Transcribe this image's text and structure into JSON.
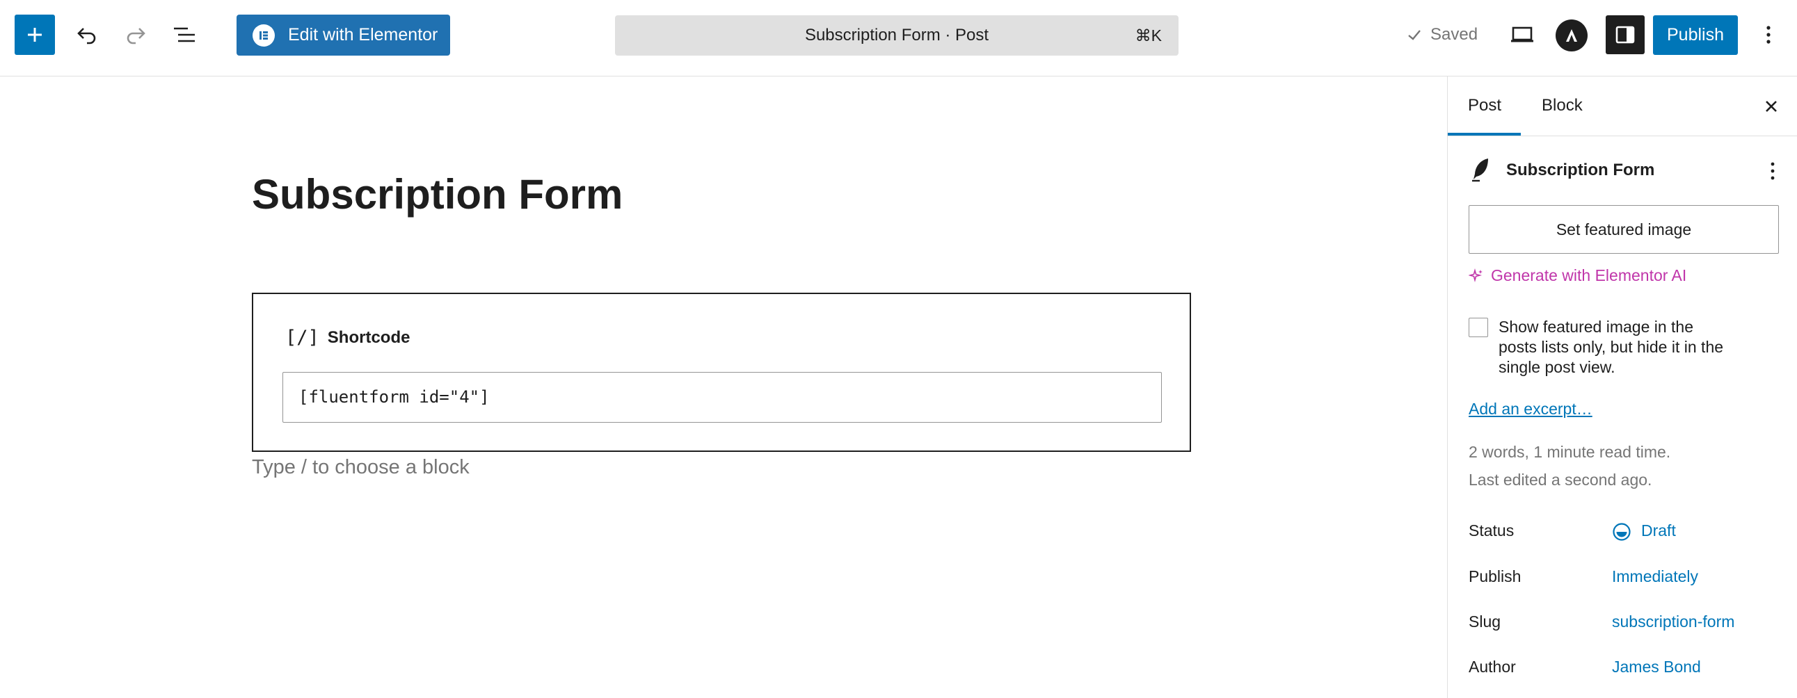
{
  "topbar": {
    "elementor_label": "Edit with Elementor",
    "command_title": "Subscription Form · Post",
    "command_shortcut": "⌘K",
    "saved_label": "Saved",
    "publish_label": "Publish"
  },
  "editor": {
    "post_title": "Subscription Form",
    "shortcode_label": "Shortcode",
    "shortcode_icon": "[/]",
    "shortcode_value": "[fluentform id=\"4\"]",
    "appender_placeholder": "Type / to choose a block"
  },
  "sidebar": {
    "tabs": [
      "Post",
      "Block"
    ],
    "post_title": "Subscription Form",
    "featured_image_button": "Set featured image",
    "generate_ai_label": "Generate with Elementor AI",
    "show_featured_checkbox_label": "Show featured image in the posts lists only, but hide it in the single post view.",
    "show_featured_checked": false,
    "excerpt_link": "Add an excerpt…",
    "word_count": "2 words, 1 minute read time.",
    "last_edited": "Last edited a second ago.",
    "rows": [
      {
        "label": "Status",
        "value": "Draft"
      },
      {
        "label": "Publish",
        "value": "Immediately"
      },
      {
        "label": "Slug",
        "value": "subscription-form"
      },
      {
        "label": "Author",
        "value": "James Bond"
      }
    ]
  },
  "colors": {
    "accent": "#0076b8",
    "elementor": "#2071b1",
    "ai": "#c036aa",
    "muted": "#757575"
  }
}
